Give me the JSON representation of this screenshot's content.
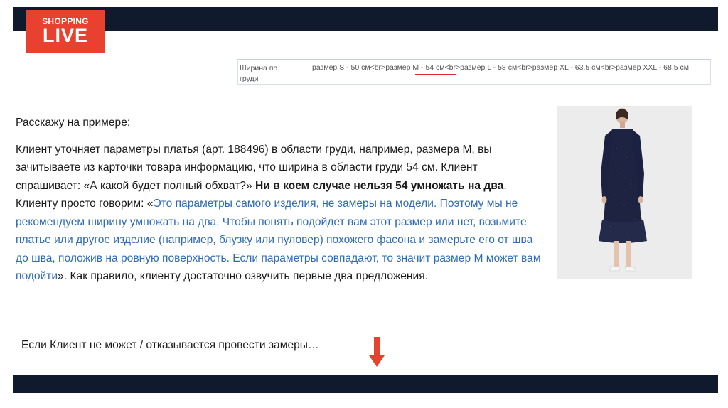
{
  "logo": {
    "line1": "SHOPPING",
    "line2": "LIVE"
  },
  "size_field": {
    "label": "Ширина по груди",
    "value": "размер S - 50 см<br>размер M - 54 см<br>размер L - 58 см<br>размер XL - 63,5 см<br>размер XXL - 68,5 см"
  },
  "content": {
    "intro": "Расскажу на примере:",
    "part1": "Клиент уточняет параметры платья (арт. 188496) в области груди, например, размера М, вы зачитываете из карточки товара информацию, что ширина в области груди 54 см. Клиент спрашивает: «А какой будет полный обхват?» ",
    "bold": "Ни в коем случае нельзя 54 умножать на два",
    "part2": ". Клиенту просто говорим: «",
    "blue1": "Это параметры самого изделия, не замеры на модели. Поэтому мы не рекомендуем ширину умножать на два. Чтобы понять подойдет вам этот размер или нет, возьмите платье или другое изделие (например, блузку или пуловер) похожего фасона и замерьте его от шва до шва, положив на ровную поверхность. Если параметры совпадают, то значит размер М может вам подойти",
    "part3": "». Как правило, клиенту достаточно озвучить первые два предложения."
  },
  "bottom_text": "Если Клиент не может / отказывается провести замеры…",
  "colors": {
    "bar": "#0f1a2c",
    "logo": "#e8412f",
    "arrow": "#e8412f",
    "link": "#2e6bb5"
  },
  "icons": {
    "arrow": "arrow-down-icon"
  }
}
